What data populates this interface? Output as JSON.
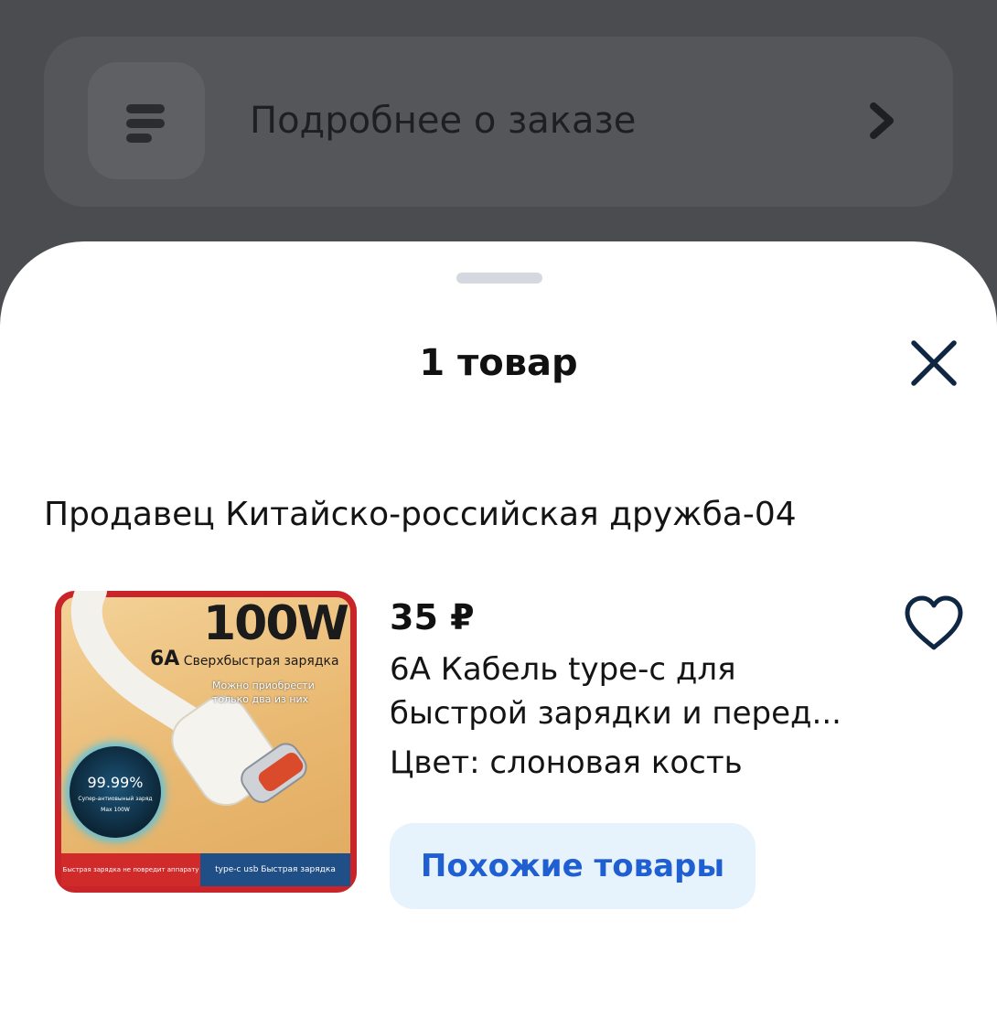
{
  "background": {
    "order_details_label": "Подробнее о заказе",
    "menu_icon": "menu-lines-icon",
    "chevron_icon": "chevron-right-icon"
  },
  "sheet": {
    "title": "1 товар",
    "close_icon": "close-icon"
  },
  "seller": {
    "label": "Продавец Китайско-российская дружба-04"
  },
  "product": {
    "price": "35 ₽",
    "name_line1": "6A Кабель type-c для",
    "name_line2": "быстрой зарядки и перед...",
    "color_text": "Цвет: слоновая кость",
    "favorite_icon": "heart-outline-icon",
    "similar_button": "Похожие товары",
    "image": {
      "headline": "100W",
      "subhead_big": "6A",
      "subhead": "Сверхбыстрая зарядка",
      "note_line1": "Можно приобрести",
      "note_line2": "только два из них",
      "circle_value": "99.99%",
      "circle_caption": "Супер-антиовыный заряд",
      "circle_badge": "Max 100W",
      "banner_left": "Быстрая зарядка не повредит аппарату",
      "banner_right": "type-c usb Быстрая зарядка"
    }
  },
  "colors": {
    "overlay": "#4b4c4f",
    "accent_blue": "#1f5fd1",
    "button_bg": "#e6f3fd",
    "icon_dark": "#0f2742"
  }
}
